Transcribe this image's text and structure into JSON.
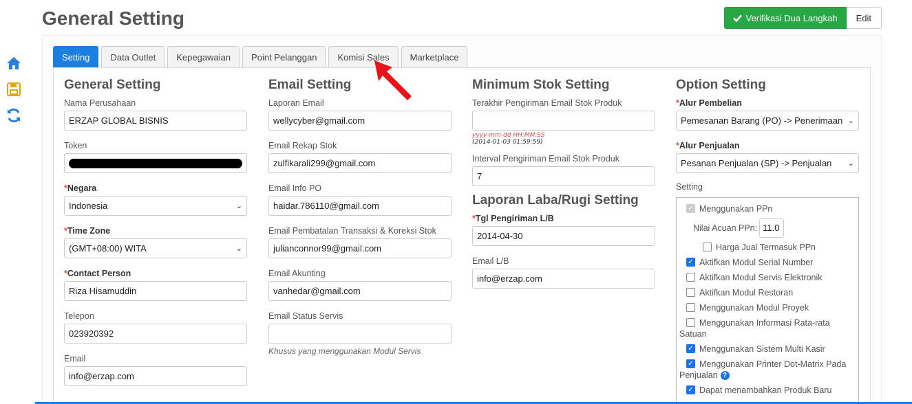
{
  "page_title": "General Setting",
  "actions": {
    "verify_label": "Verifikasi Dua Langkah",
    "edit_label": "Edit"
  },
  "tabs": [
    {
      "label": "Setting",
      "active": true
    },
    {
      "label": "Data Outlet"
    },
    {
      "label": "Kepegawaian"
    },
    {
      "label": "Point Pelanggan"
    },
    {
      "label": "Komisi Sales"
    },
    {
      "label": "Marketplace"
    }
  ],
  "general": {
    "heading": "General Setting",
    "nama_perusahaan": {
      "label": "Nama Perusahaan",
      "value": "ERZAP GLOBAL BISNIS"
    },
    "token": {
      "label": "Token"
    },
    "negara": {
      "label": "Negara",
      "value": "Indonesia"
    },
    "timezone": {
      "label": "Time Zone",
      "value": "(GMT+08:00) WITA"
    },
    "contact": {
      "label": "Contact Person",
      "value": "Riza Hisamuddin"
    },
    "telepon": {
      "label": "Telepon",
      "value": "023920392"
    },
    "email": {
      "label": "Email",
      "value": "info@erzap.com"
    }
  },
  "email_setting": {
    "heading": "Email Setting",
    "laporan": {
      "label": "Laporan Email",
      "value": "wellycyber@gmail.com"
    },
    "rekap": {
      "label": "Email Rekap Stok",
      "value": "zulfikarali299@gmail.com"
    },
    "info_po": {
      "label": "Email Info PO",
      "value": "haidar.786110@gmail.com"
    },
    "pembatalan": {
      "label": "Email Pembatalan Transaksi & Koreksi Stok",
      "value": "julianconnor99@gmail.com"
    },
    "akunting": {
      "label": "Email Akunting",
      "value": "vanhedar@gmail.com"
    },
    "servis": {
      "label": "Email Status Servis",
      "value": "",
      "hint": "Khusus yang menggunakan Modul Servis"
    }
  },
  "min_stok": {
    "heading": "Minimum Stok Setting",
    "terakhir": {
      "label": "Terakhir Pengiriman Email Stok Produk",
      "value": "",
      "hint_format": "yyyy-mm-dd HH:MM:SS",
      "hint_example": "(2014-01-03 01:59:59)"
    },
    "interval": {
      "label": "Interval Pengiriman Email Stok Produk",
      "value": "7"
    }
  },
  "laba_rugi": {
    "heading": "Laporan Laba/Rugi Setting",
    "tgl": {
      "label": "Tgl Pengiriman L/B",
      "value": "2014-04-30"
    },
    "email": {
      "label": "Email L/B",
      "value": "info@erzap.com"
    }
  },
  "option": {
    "heading": "Option Setting",
    "alur_pembelian": {
      "label": "Alur Pembelian",
      "value": "Pemesanan Barang (PO) -> Penerimaan Barang"
    },
    "alur_penjualan": {
      "label": "Alur Penjualan",
      "value": "Pesanan Penjualan (SP) -> Penjualan"
    },
    "setting_label": "Setting",
    "ppn": "Menggunakan PPn",
    "nilai_acuan_label": "Nilai Acuan PPn:",
    "nilai_acuan_value": "11.0",
    "harga_jual": "Harga Jual Termasuk PPn",
    "serial": "Aktifkan Modul Serial Number",
    "servis": "Aktifkan Modul Servis Elektronik",
    "restoran": "Aktifkan Modul Restoran",
    "proyek": "Menggunakan Modul Proyek",
    "rata_rata": "Menggunakan Informasi Rata-rata",
    "rata_rata_2": "Satuan",
    "multi_kasir": "Menggunakan Sistem Multi Kasir",
    "dot_matrix": "Menggunakan Printer Dot-Matrix Pada",
    "dot_matrix_2": "Penjualan",
    "produk_baru": "Dapat menambahkan Produk Baru"
  },
  "colors": {
    "accent": "#1a7fe0",
    "success": "#28a745",
    "required": "#d9534f"
  }
}
